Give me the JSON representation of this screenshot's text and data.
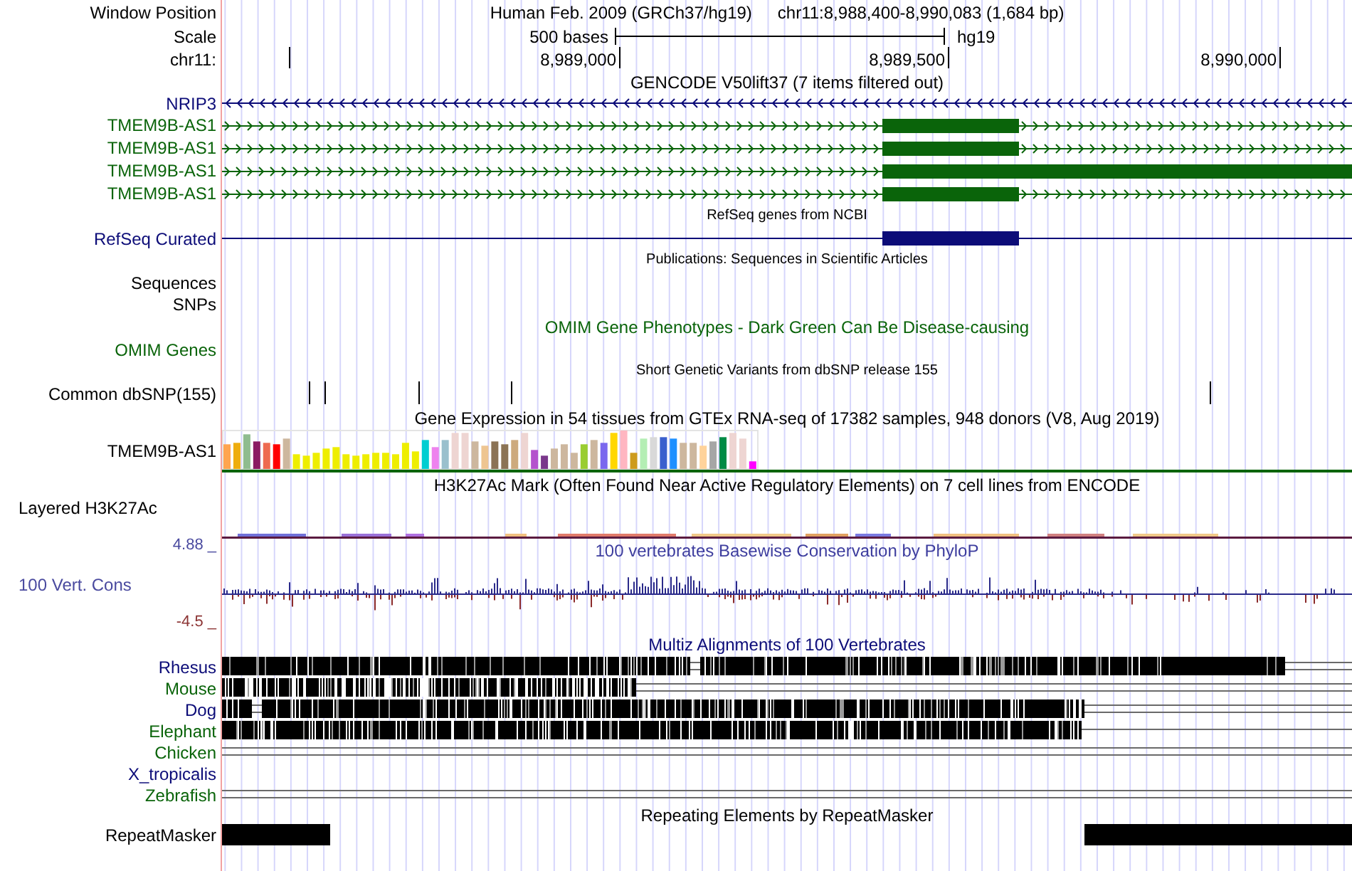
{
  "window_position": {
    "label": "Window Position",
    "assembly": "Human Feb. 2009 (GRCh37/hg19)",
    "position": "chr11:8,988,400-8,990,083 (1,684 bp)"
  },
  "scale": {
    "label": "Scale",
    "length": "500 bases",
    "assembly": "hg19"
  },
  "ruler": {
    "label": "chr11:",
    "ticks": [
      "8,989,000",
      "8,989,500",
      "8,990,000"
    ]
  },
  "gencode": {
    "title": "GENCODE V50lift37 (7 items filtered out)",
    "genes": [
      {
        "label": "NRIP3",
        "color": "#0c0c78",
        "minus_strand": true
      },
      {
        "label": "TMEM9B-AS1",
        "color": "#0a640a",
        "minus_strand": false
      },
      {
        "label": "TMEM9B-AS1",
        "color": "#0a640a",
        "minus_strand": false
      },
      {
        "label": "TMEM9B-AS1",
        "color": "#0a640a",
        "minus_strand": false
      },
      {
        "label": "TMEM9B-AS1",
        "color": "#0a640a",
        "minus_strand": false
      }
    ]
  },
  "refseq": {
    "title": "RefSeq genes from NCBI",
    "label": "RefSeq Curated"
  },
  "publications": {
    "title": "Publications: Sequences in Scientific Articles",
    "labels": [
      "Sequences",
      "SNPs"
    ]
  },
  "omim": {
    "title": "OMIM Gene Phenotypes - Dark Green Can Be Disease-causing",
    "label": "OMIM Genes"
  },
  "dbsnp": {
    "title": "Short Genetic Variants from dbSNP release 155",
    "label": "Common dbSNP(155)"
  },
  "gtex": {
    "title": "Gene Expression in 54 tissues from GTEx RNA-seq of 17382 samples, 948 donors (V8, Aug 2019)",
    "label": "TMEM9B-AS1"
  },
  "h3k27ac": {
    "title": "H3K27Ac Mark (Often Found Near Active Regulatory Elements) on 7 cell lines from ENCODE",
    "label": "Layered H3K27Ac"
  },
  "conservation": {
    "title": "100 vertebrates Basewise Conservation by PhyloP",
    "max_label": "4.88 _",
    "label": "100 Vert. Cons",
    "min_label": "-4.5 _"
  },
  "multiz": {
    "title": "Multiz Alignments of 100 Vertebrates",
    "species": [
      {
        "label": "Rhesus",
        "color": "#0c0c78"
      },
      {
        "label": "Mouse",
        "color": "#0a640a"
      },
      {
        "label": "Dog",
        "color": "#0c0c78"
      },
      {
        "label": "Elephant",
        "color": "#0a640a"
      },
      {
        "label": "Chicken",
        "color": "#0a640a"
      },
      {
        "label": "X_tropicalis",
        "color": "#0c0c78"
      },
      {
        "label": "Zebrafish",
        "color": "#0a640a"
      }
    ]
  },
  "repeatmasker": {
    "title": "Repeating Elements by RepeatMasker",
    "label": "RepeatMasker"
  }
}
